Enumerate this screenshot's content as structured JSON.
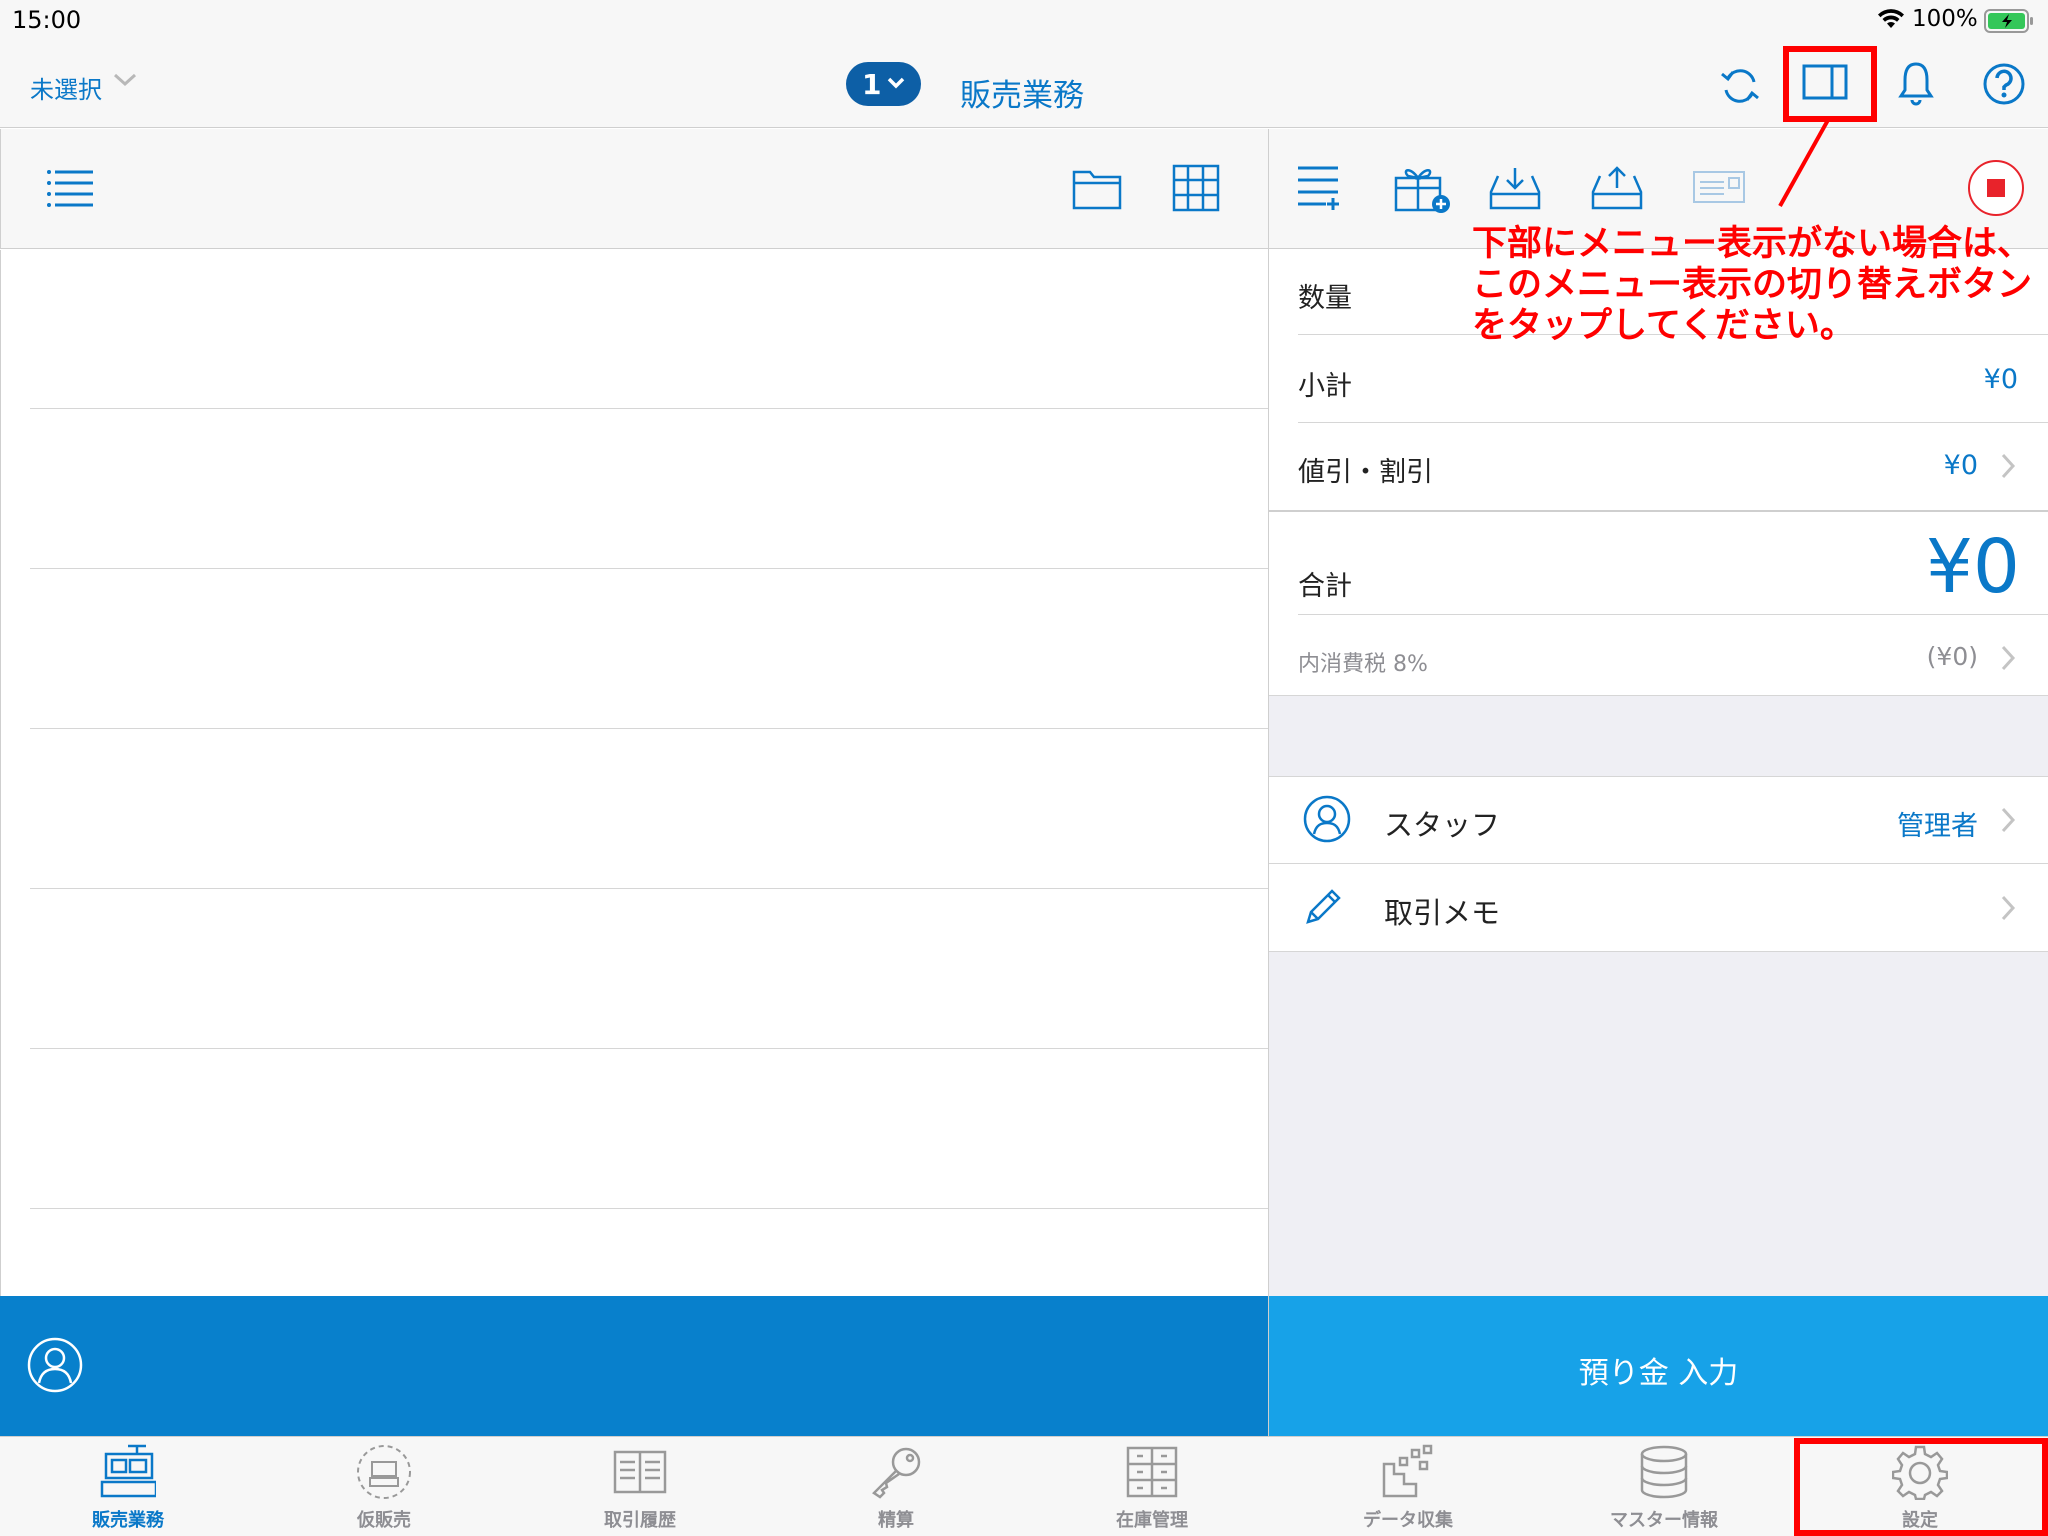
{
  "status_bar": {
    "time": "15:00",
    "battery_percent": "100%"
  },
  "nav": {
    "store_selector": "未選択",
    "register_number": "1",
    "title": "販売業務"
  },
  "summary": {
    "quantity_label": "数量",
    "subtotal_label": "小計",
    "subtotal_value": "¥0",
    "discount_label": "値引・割引",
    "discount_value": "¥0",
    "total_label": "合計",
    "total_value": "¥0",
    "tax_label": "内消費税 8%",
    "tax_value": "(¥0)"
  },
  "staff": {
    "label": "スタッフ",
    "value": "管理者"
  },
  "memo": {
    "label": "取引メモ"
  },
  "deposit_button": "預り金 入力",
  "tabs": [
    {
      "label": "販売業務",
      "icon": "register-icon",
      "active": true
    },
    {
      "label": "仮販売",
      "icon": "temp-register-icon",
      "active": false
    },
    {
      "label": "取引履歴",
      "icon": "ledger-icon",
      "active": false
    },
    {
      "label": "精算",
      "icon": "key-icon",
      "active": false
    },
    {
      "label": "在庫管理",
      "icon": "cabinet-icon",
      "active": false
    },
    {
      "label": "データ収集",
      "icon": "data-icon",
      "active": false
    },
    {
      "label": "マスター情報",
      "icon": "database-icon",
      "active": false
    },
    {
      "label": "設定",
      "icon": "gear-icon",
      "active": false
    }
  ],
  "annotation": {
    "text": "下部にメニュー表示がない場合は、このメニュー表示の切り替えボタンをタップしてください。"
  },
  "colors": {
    "accent": "#0a78c8",
    "customer_bar": "#0880cc",
    "deposit_button": "#17a2e8",
    "stop": "#e8232b",
    "annotation": "#ff0000"
  }
}
